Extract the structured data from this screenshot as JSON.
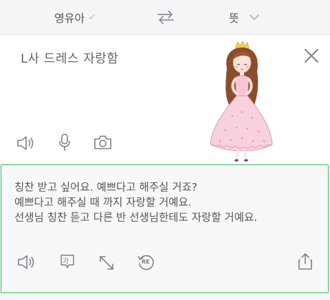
{
  "language_bar": {
    "source_language": "영유아",
    "target_language": "뜻",
    "source_check": "✔",
    "swap_icon": "swap-arrows-icon",
    "target_dropdown_icon": "chevron-down-icon"
  },
  "input": {
    "text": "L사 드레스 자랑함",
    "clear_icon": "close-icon",
    "tools": [
      "speaker-icon",
      "microphone-icon",
      "camera-icon"
    ]
  },
  "output": {
    "lines": [
      "칭찬 받고 싶어요. 예쁘다고 해주실 거죠?",
      "예쁘다고 해주실 때 까지 자랑할 거예요.",
      "선생님 칭찬 듣고 다른 반 선생님한테도 자랑할 거예요."
    ],
    "tools": [
      "speaker-icon",
      "korean-input-icon",
      "expand-icon",
      "retranslate-icon",
      "share-icon"
    ],
    "retranslate_badge": "RE",
    "korean_badge": "가"
  },
  "colors": {
    "accent_green": "#3cc056",
    "icon_gray": "#7a7f86",
    "dress_pink": "#f7c6d6",
    "crown_yellow": "#f3d34a"
  }
}
